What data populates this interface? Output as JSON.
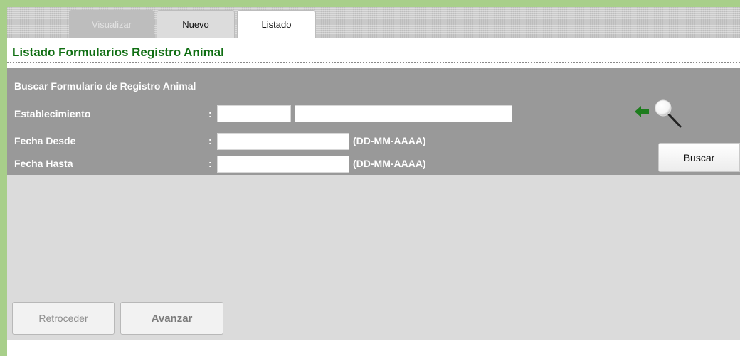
{
  "tabs": [
    {
      "label": "Visualizar",
      "state": "disabled"
    },
    {
      "label": "Nuevo",
      "state": "normal"
    },
    {
      "label": "Listado",
      "state": "active"
    }
  ],
  "page_title": "Listado Formularios Registro Animal",
  "search": {
    "title": "Buscar  Formulario de Registro Animal",
    "fields": [
      {
        "label": "Establecimiento",
        "colon": ":",
        "code_value": "",
        "name_value": ""
      },
      {
        "label": "Fecha Desde",
        "colon": ":",
        "value": "",
        "hint": "(DD-MM-AAAA)"
      },
      {
        "label": "Fecha Hasta",
        "colon": ":",
        "value": "",
        "hint": "(DD-MM-AAAA)"
      }
    ],
    "lookup_icons": [
      "arrow-left-icon",
      "magnifier-icon"
    ],
    "buscar_label": "Buscar"
  },
  "navigation": {
    "prev_label": "Retroceder",
    "next_label": "Avanzar"
  },
  "colors": {
    "title_green": "#0f6e12",
    "panel_gray": "#999999",
    "results_gray": "#dbdbdb",
    "outer_green": "#a8cf8a"
  }
}
